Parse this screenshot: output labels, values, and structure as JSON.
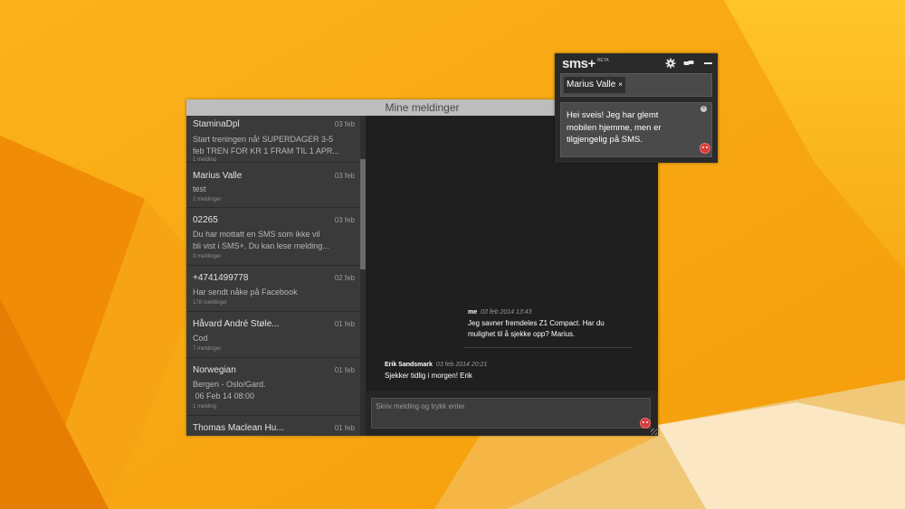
{
  "main_window": {
    "title": "Mine meldinger"
  },
  "conversations": [
    {
      "name": "StaminaDpl",
      "date": "03 feb",
      "preview_lines": [
        "Start treningen nå! SUPERDAGER 3-5",
        "feb TREN FOR KR 1 FRAM TIL  1 APR..."
      ],
      "count": "1 melding"
    },
    {
      "name": "Marius Valle",
      "date": "03 feb",
      "preview_lines": [
        "test"
      ],
      "count": "2 meldinger"
    },
    {
      "name": "02265",
      "date": "03 feb",
      "preview_lines": [
        "Du har mottatt en SMS som ikke vil",
        "bli vist i SMS+. Du kan lese melding..."
      ],
      "count": "3 meldinger"
    },
    {
      "name": "+4741499778",
      "date": "02 feb",
      "preview_lines": [
        "Har sendt nåke på Facebook"
      ],
      "count": "178 meldinger"
    },
    {
      "name": "Håvard André Støle...",
      "date": "01 feb",
      "preview_lines": [
        "Cod"
      ],
      "count": "7 meldinger"
    },
    {
      "name": "Norwegian",
      "date": "01 feb",
      "preview_lines": [
        "Bergen - Oslo/Gard.",
        " 06 Feb 14 08:00"
      ],
      "count": "1 melding"
    },
    {
      "name": "Thomas Maclean Hu...",
      "date": "01 feb",
      "preview_lines": [],
      "count": ""
    }
  ],
  "messages": [
    {
      "sender": "me",
      "time": "03 feb 2014 13:43",
      "lines": [
        "Jeg savner fremdeles Z1 Compact. Har du",
        "mulighet til å sjekke opp? Marius."
      ]
    },
    {
      "sender": "Erik Sandsmark",
      "time": "03 feb 2014 20:21",
      "lines": [
        "Sjekker tidlig i morgen! Erik"
      ]
    }
  ],
  "compose": {
    "placeholder": "Skriv melding og trykk enter"
  },
  "popup": {
    "logo": "sms+",
    "beta": "BETA",
    "recipient": "Marius Valle",
    "recipient_remove": "×",
    "message_lines": [
      "Hei sveis! Jeg har glemt",
      "mobilen hjemme, men er",
      "tilgjengelig på SMS."
    ],
    "clear": "×",
    "settings_icon": "gear-icon",
    "contacts_icon": "link-icon",
    "minimize_icon": "minimize-icon"
  },
  "colors": {
    "desktop_orange": "#f5a60c",
    "desktop_yellow": "#fbbf1e",
    "list_bg": "#3a3a3a",
    "chat_bg": "#1f1f1f",
    "titlebar": "#bdbdbd"
  }
}
